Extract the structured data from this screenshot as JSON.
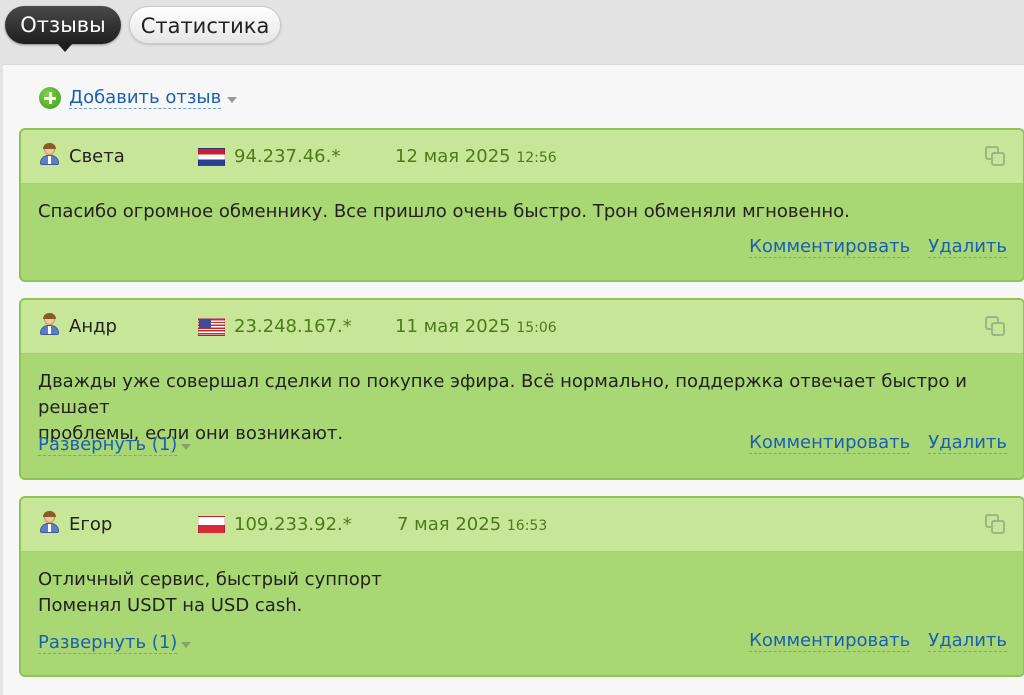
{
  "tabs": [
    {
      "label": "Отзывы",
      "active": true
    },
    {
      "label": "Статистика",
      "active": false
    }
  ],
  "add_review": {
    "label": "Добавить отзыв"
  },
  "reviews": [
    {
      "author": "Света",
      "flag": "nl-flag-icon",
      "ip": "94.237.46.*",
      "date": "12 мая 2025",
      "time": "12:56",
      "text_lines": [
        "Спасибо огромное обменнику. Все пришло очень быстро. Трон обменяли мгновенно."
      ],
      "expand": null
    },
    {
      "author": "Андр",
      "flag": "us-flag-icon",
      "ip": "23.248.167.*",
      "date": "11 мая 2025",
      "time": "15:06",
      "text_lines": [
        "Дважды уже совершал сделки по покупке эфира. Всё нормально, поддержка отвечает быстро и решает",
        "проблемы, если они возникают."
      ],
      "expand": "Развернуть (1)"
    },
    {
      "author": "Егор",
      "flag": "pl-flag-icon",
      "ip": "109.233.92.*",
      "date": "7 мая 2025",
      "time": "16:53",
      "text_lines": [
        "Отличный сервис, быстрый суппорт",
        "Поменял USDT на USD cash."
      ],
      "expand": "Развернуть (1)"
    }
  ],
  "actions": {
    "comment": "Комментировать",
    "delete": "Удалить"
  },
  "colors": {
    "card_body": "#a9d773",
    "card_header": "#c8e698",
    "ip_date_text": "#4d7a1a",
    "link": "#1a5fb4",
    "active_tab": "#1e1e1e"
  }
}
